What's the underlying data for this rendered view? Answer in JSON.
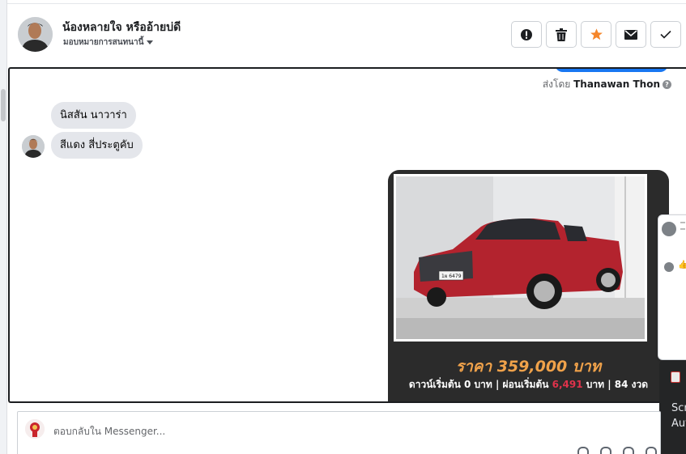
{
  "header": {
    "contact_name": "น้องหลายใจ หรืออ้ายบ่ดี",
    "assign_label": "มอบหมายการสนทนานี้",
    "actions": [
      {
        "name": "mark-spam-button",
        "icon": "exclamation-icon"
      },
      {
        "name": "delete-button",
        "icon": "trash-icon"
      },
      {
        "name": "star-button",
        "icon": "star-icon"
      },
      {
        "name": "mark-unread-button",
        "icon": "envelope-icon"
      },
      {
        "name": "mark-done-button",
        "icon": "check-icon"
      }
    ]
  },
  "thread": {
    "sent_by_prefix": "ส่งโดย",
    "sent_by_name": "Thanawan Thon",
    "messages": [
      {
        "text": "นิสสัน นาวาร่า"
      },
      {
        "text": "สีแดง สี่ประตูคับ"
      }
    ],
    "card": {
      "plate": "1ผ 6479",
      "price_text": "ราคา 359,000 บาท",
      "terms_prefix": "ดาวน์เริ่มต้น 0 บาท | ผ่อนเริ่มต้น",
      "terms_amount": "6,491",
      "terms_suffix": "บาท | 84 งวด"
    }
  },
  "toast": {
    "line1": "Scr",
    "line2": "Aut"
  },
  "composer": {
    "placeholder": "ตอบกลับใน Messenger..."
  },
  "colors": {
    "accent": "#1877f2",
    "star": "#f5862a",
    "price": "#f0a24a",
    "highlight": "#e0324b",
    "card_bg": "#2b2b2b"
  }
}
